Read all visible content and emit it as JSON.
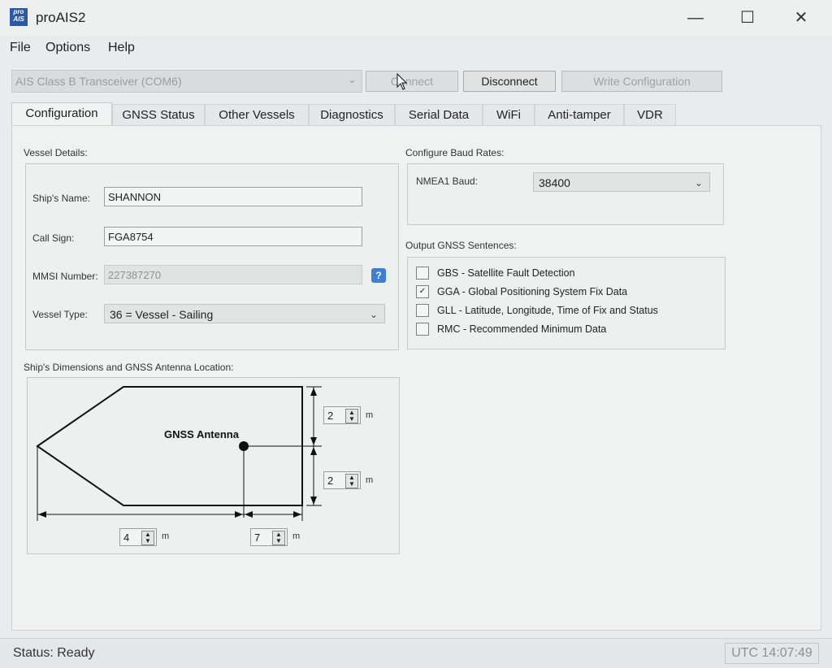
{
  "window": {
    "app_icon_text": "pro AIS",
    "title": "proAIS2",
    "minimize_glyph": "—",
    "maximize_glyph": "☐",
    "close_glyph": "✕"
  },
  "menu": [
    "File",
    "Options",
    "Help"
  ],
  "toolbar": {
    "device_select": "AIS Class B Transceiver (COM6)",
    "connect_label": "Connect",
    "disconnect_label": "Disconnect",
    "write_config_label": "Write Configuration"
  },
  "tabs": [
    "Configuration",
    "GNSS Status",
    "Other Vessels",
    "Diagnostics",
    "Serial Data",
    "WiFi",
    "Anti-tamper",
    "VDR"
  ],
  "active_tab": "Configuration",
  "vessel_details": {
    "group_label": "Vessel Details:",
    "ship_name_label": "Ship's Name:",
    "ship_name_value": "SHANNON",
    "call_sign_label": "Call Sign:",
    "call_sign_value": "FGA8754",
    "mmsi_label": "MMSI Number:",
    "mmsi_value": "227387270",
    "help_icon_text": "?",
    "vessel_type_label": "Vessel Type:",
    "vessel_type_value": "36 = Vessel - Sailing"
  },
  "baud_rates": {
    "group_label": "Configure Baud Rates:",
    "nmea1_label": "NMEA1 Baud:",
    "nmea1_value": "38400"
  },
  "gnss_sentences": {
    "group_label": "Output GNSS Sentences:",
    "items": [
      {
        "label": "GBS - Satellite Fault Detection",
        "checked": false
      },
      {
        "label": "GGA - Global Positioning System Fix Data",
        "checked": true
      },
      {
        "label": "GLL - Latitude, Longitude, Time of Fix and Status",
        "checked": false
      },
      {
        "label": "RMC - Recommended Minimum Data",
        "checked": false
      }
    ]
  },
  "dimensions": {
    "group_label": "Ship's Dimensions and GNSS Antenna Location:",
    "antenna_label": "GNSS Antenna",
    "top_value": "2",
    "bottom_value": "2",
    "left_value": "4",
    "right_value": "7",
    "unit": "m"
  },
  "status": {
    "text": "Status: Ready",
    "clock": "UTC 14:07:49"
  }
}
